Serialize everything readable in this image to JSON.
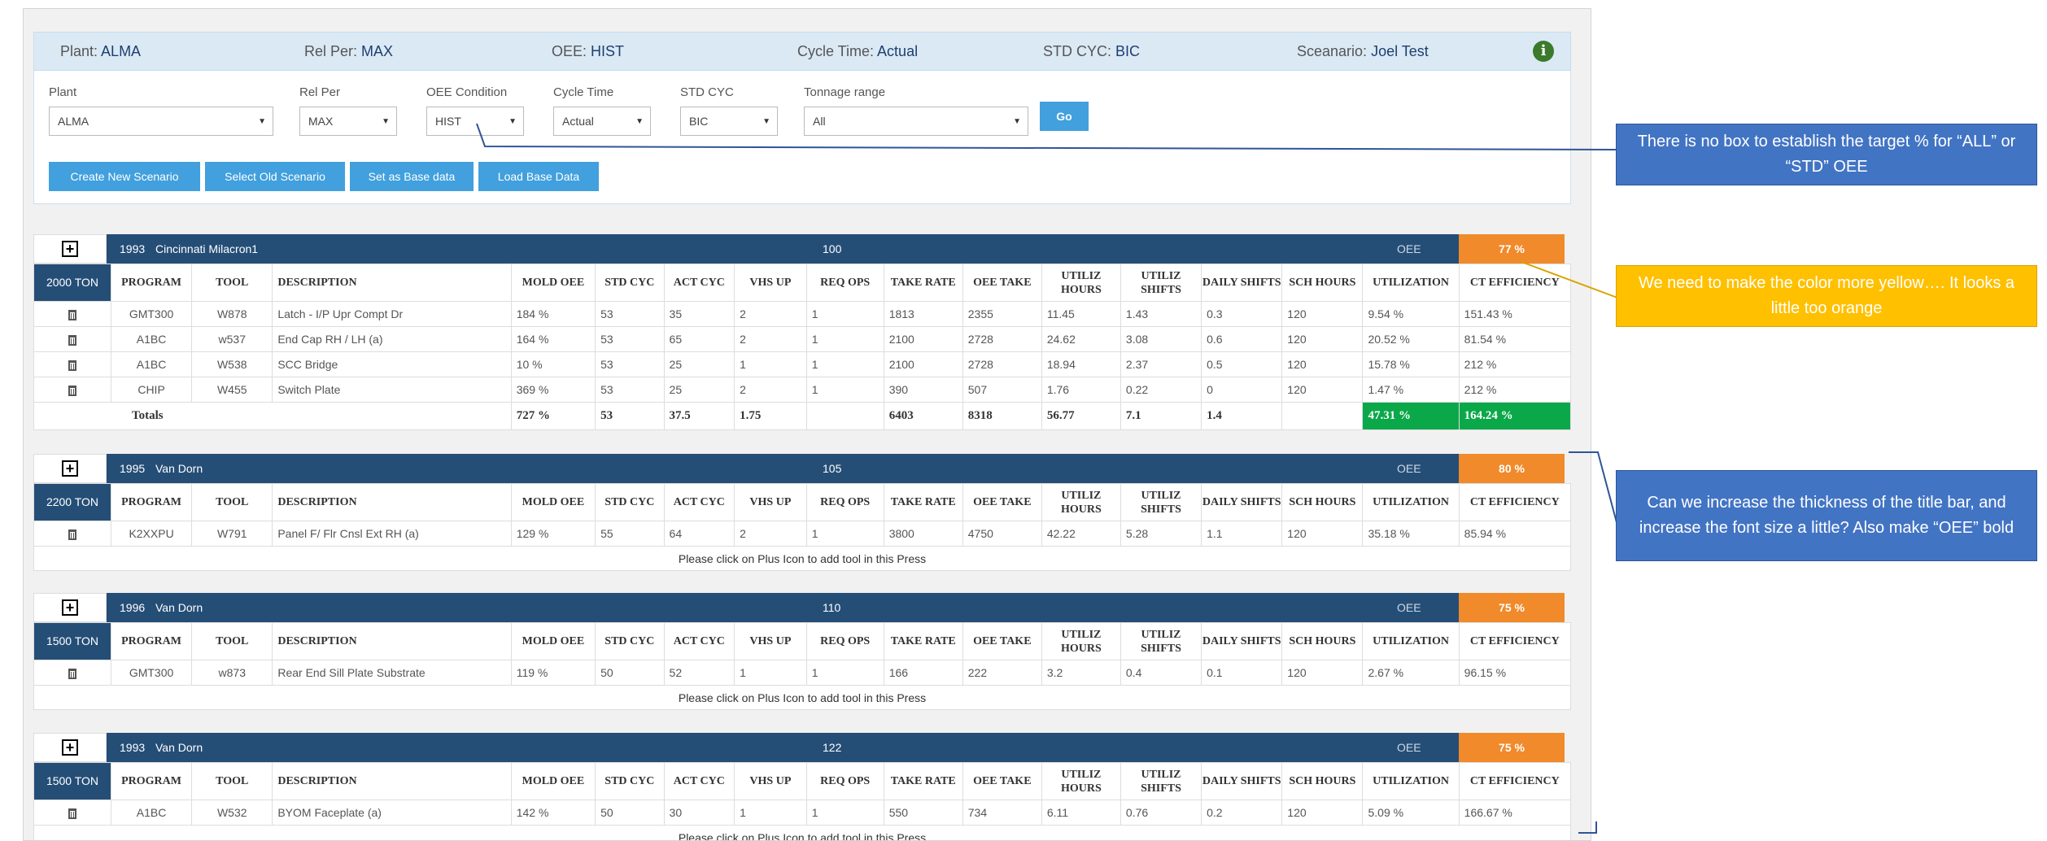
{
  "summary": {
    "plant_label": "Plant:",
    "plant_value": "ALMA",
    "relper_label": "Rel Per:",
    "relper_value": "MAX",
    "oee_label": "OEE:",
    "oee_value": "HIST",
    "cycle_label": "Cycle Time:",
    "cycle_value": "Actual",
    "stdcyc_label": "STD CYC:",
    "stdcyc_value": "BIC",
    "scenario_label": "Sceanario:",
    "scenario_value": "Joel Test",
    "info_icon": "info-circle-icon"
  },
  "filters": {
    "plant": {
      "label": "Plant",
      "value": "ALMA"
    },
    "relper": {
      "label": "Rel Per",
      "value": "MAX"
    },
    "oee": {
      "label": "OEE Condition",
      "value": "HIST"
    },
    "cycle": {
      "label": "Cycle Time",
      "value": "Actual"
    },
    "stdcyc": {
      "label": "STD CYC",
      "value": "BIC"
    },
    "tonnage": {
      "label": "Tonnage range",
      "value": "All"
    },
    "go_label": "Go"
  },
  "actions": {
    "create": "Create New Scenario",
    "select": "Select Old Scenario",
    "set_base": "Set as Base data",
    "load_base": "Load Base Data"
  },
  "columns": [
    "PROGRAM",
    "TOOL",
    "DESCRIPTION",
    "MOLD OEE",
    "STD CYC",
    "ACT CYC",
    "VHS UP",
    "REQ OPS",
    "TAKE RATE",
    "OEE TAKE",
    "UTILIZ HOURS",
    "UTILIZ SHIFTS",
    "DAILY SHIFTS",
    "SCH HOURS",
    "UTILIZATION",
    "CT EFFICIENCY"
  ],
  "oee_text": "OEE",
  "hint_text": "Please click on Plus Icon to add tool in this Press",
  "presses": [
    {
      "id": "1993",
      "name": "Cincinnati Milacron1",
      "num": "100",
      "oee_pct": "77 %",
      "tonnage": "2000 TON",
      "rows": [
        [
          "GMT300",
          "W878",
          "Latch - I/P Upr Compt Dr",
          "184 %",
          "53",
          "35",
          "2",
          "1",
          "1813",
          "2355",
          "11.45",
          "1.43",
          "0.3",
          "120",
          "9.54 %",
          "151.43 %"
        ],
        [
          "A1BC",
          "w537",
          "End Cap RH / LH (a)",
          "164 %",
          "53",
          "65",
          "2",
          "1",
          "2100",
          "2728",
          "24.62",
          "3.08",
          "0.6",
          "120",
          "20.52 %",
          "81.54 %"
        ],
        [
          "A1BC",
          "W538",
          "SCC Bridge",
          "10 %",
          "53",
          "25",
          "1",
          "1",
          "2100",
          "2728",
          "18.94",
          "2.37",
          "0.5",
          "120",
          "15.78 %",
          "212 %"
        ],
        [
          "CHIP",
          "W455",
          "Switch Plate",
          "369 %",
          "53",
          "25",
          "2",
          "1",
          "390",
          "507",
          "1.76",
          "0.22",
          "0",
          "120",
          "1.47 %",
          "212 %"
        ]
      ],
      "totals": {
        "label": "Totals",
        "values": [
          "727 %",
          "53",
          "37.5",
          "1.75",
          "",
          "6403",
          "8318",
          "56.77",
          "7.1",
          "1.4",
          "",
          "47.31 %",
          "164.24 %"
        ]
      }
    },
    {
      "id": "1995",
      "name": "Van Dorn",
      "num": "105",
      "oee_pct": "80 %",
      "tonnage": "2200 TON",
      "rows": [
        [
          "K2XXPU",
          "W791",
          "Panel F/ Flr Cnsl Ext RH (a)",
          "129 %",
          "55",
          "64",
          "2",
          "1",
          "3800",
          "4750",
          "42.22",
          "5.28",
          "1.1",
          "120",
          "35.18 %",
          "85.94 %"
        ]
      ]
    },
    {
      "id": "1996",
      "name": "Van Dorn",
      "num": "110",
      "oee_pct": "75 %",
      "tonnage": "1500 TON",
      "rows": [
        [
          "GMT300",
          "w873",
          "Rear End Sill Plate Substrate",
          "119 %",
          "50",
          "52",
          "1",
          "1",
          "166",
          "222",
          "3.2",
          "0.4",
          "0.1",
          "120",
          "2.67 %",
          "96.15 %"
        ]
      ]
    },
    {
      "id": "1993",
      "name": "Van Dorn",
      "num": "122",
      "oee_pct": "75 %",
      "tonnage": "1500 TON",
      "rows": [
        [
          "A1BC",
          "W532",
          "BYOM Faceplate (a)",
          "142 %",
          "50",
          "30",
          "1",
          "1",
          "550",
          "734",
          "6.11",
          "0.76",
          "0.2",
          "120",
          "5.09 %",
          "166.67 %"
        ]
      ]
    }
  ],
  "callouts": {
    "target_box": "There is no box to establish the target % for “ALL” or “STD” OEE",
    "color": "We need to make the color more yellow…. It looks a little too orange",
    "title_bar": "Can we increase the thickness of the title bar, and increase the font size a little?  Also make “OEE” bold"
  },
  "colors": {
    "title_bar": "#254e77",
    "oee_badge": "#f08a2a",
    "button": "#41a0dd",
    "totals_green": "#0ba84a",
    "callout_blue": "#4274c4",
    "callout_yellow": "#ffc000"
  }
}
